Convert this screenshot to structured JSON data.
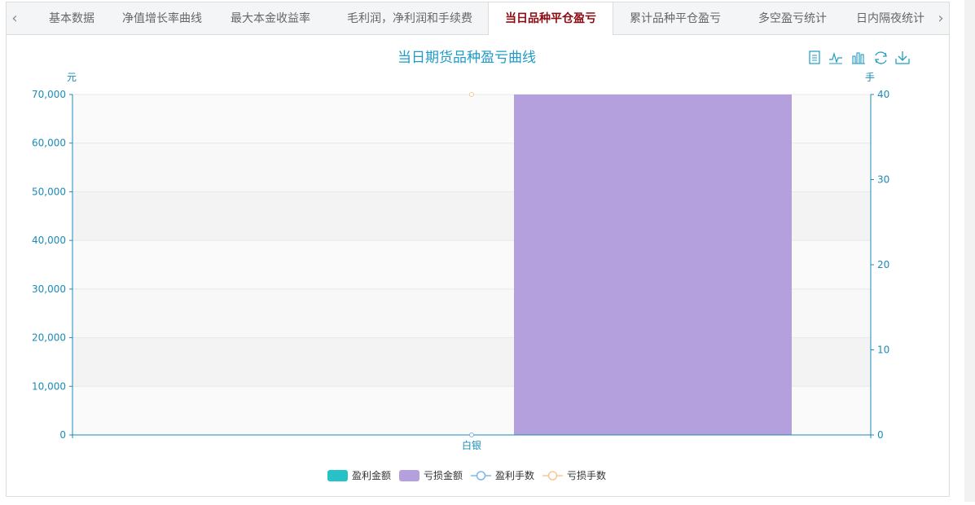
{
  "tabs": [
    {
      "label": "基本数据",
      "active": false
    },
    {
      "label": "净值增长率曲线",
      "active": false
    },
    {
      "label": "最大本金收益率",
      "active": false
    },
    {
      "label": "毛利润，净利润和手续费",
      "active": false
    },
    {
      "label": "当日品种平仓盈亏",
      "active": true
    },
    {
      "label": "累计品种平仓盈亏",
      "active": false
    },
    {
      "label": "多空盈亏统计",
      "active": false
    },
    {
      "label": "日内隔夜统计",
      "active": false
    }
  ],
  "toolbar": {
    "icons": [
      "data-view-icon",
      "line-chart-icon",
      "bar-chart-icon",
      "restore-icon",
      "download-icon"
    ]
  },
  "colors": {
    "accent": "#1f9bc5",
    "axis": "#1b8bb8",
    "profit_bar": "#26c2c8",
    "loss_bar": "#b5a0de",
    "profit_line": "#7eb6e6",
    "loss_line": "#f4c89a",
    "active_tab": "#8a0b12"
  },
  "chart_data": {
    "type": "bar",
    "title": "当日期货品种盈亏曲线",
    "categories": [
      "白银"
    ],
    "y_left_unit": "元",
    "y_right_unit": "手",
    "ylim_left": [
      0,
      70000
    ],
    "ylim_right": [
      0,
      40
    ],
    "yticks_left": [
      "0",
      "10,000",
      "20,000",
      "30,000",
      "40,000",
      "50,000",
      "60,000",
      "70,000"
    ],
    "yticks_right": [
      "0",
      "10",
      "20",
      "30",
      "40"
    ],
    "series": [
      {
        "name": "盈利金额",
        "kind": "bar",
        "axis": "left",
        "values": [
          0
        ]
      },
      {
        "name": "亏损金额",
        "kind": "bar",
        "axis": "left",
        "values": [
          70000
        ]
      },
      {
        "name": "盈利手数",
        "kind": "line",
        "axis": "right",
        "values": [
          0
        ]
      },
      {
        "name": "亏损手数",
        "kind": "line",
        "axis": "right",
        "values": [
          40
        ]
      }
    ],
    "legend_position": "bottom-center",
    "grid": true
  }
}
